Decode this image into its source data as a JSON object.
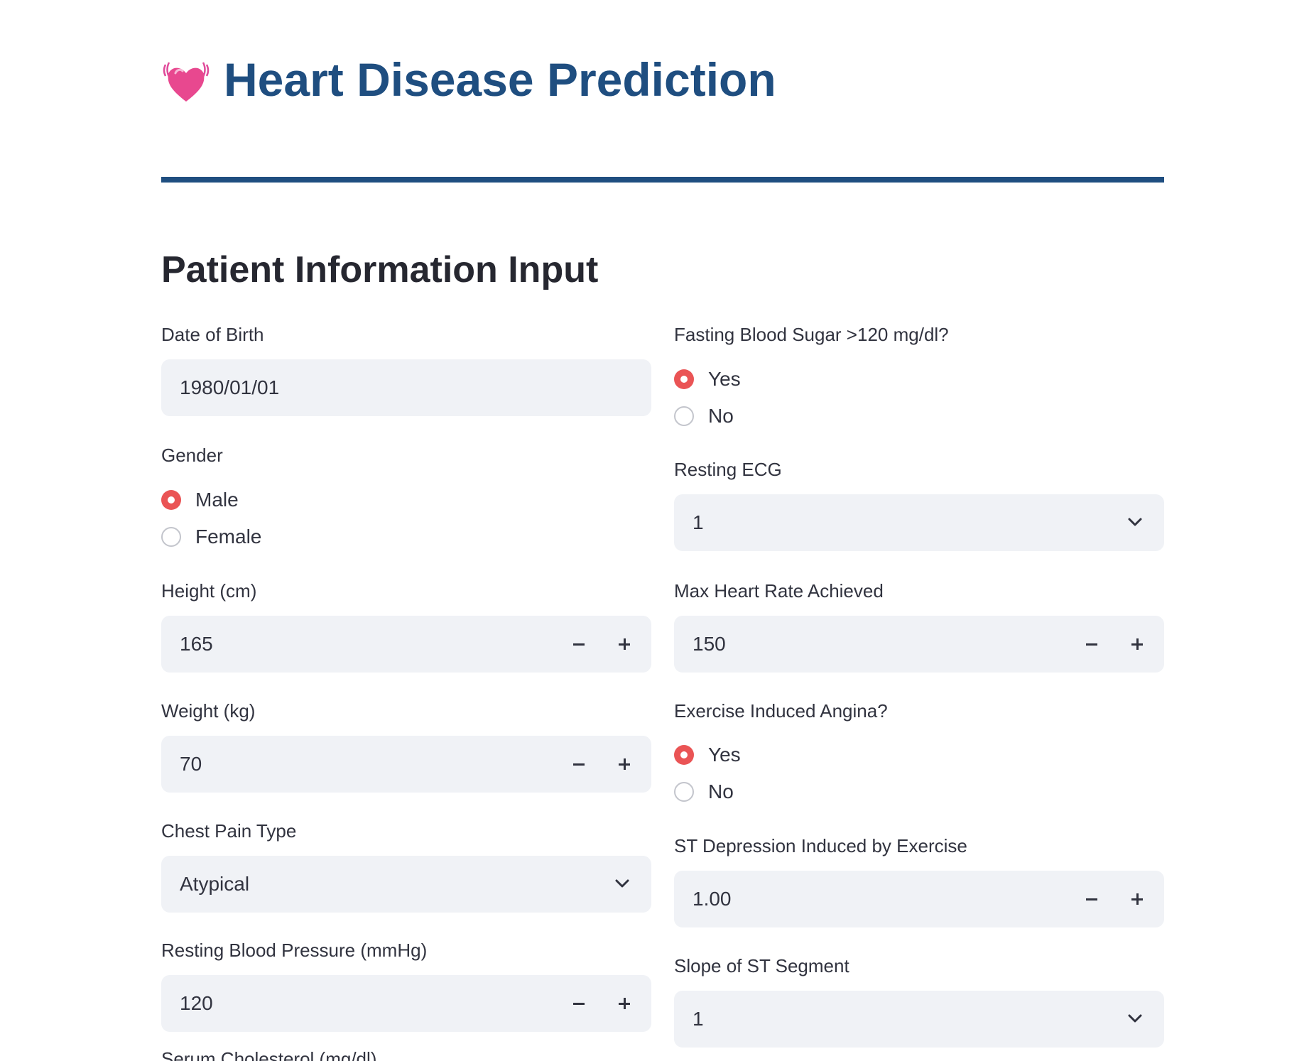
{
  "header": {
    "icon": "beating-heart-icon",
    "title": "Heart Disease Prediction"
  },
  "colors": {
    "title": "#1f4e80",
    "rule": "#1f4e80",
    "radio_checked": "#ea5455",
    "input_bg": "#f0f2f6"
  },
  "section_title": "Patient Information Input",
  "left": {
    "dob": {
      "label": "Date of Birth",
      "value": "1980/01/01"
    },
    "gender": {
      "label": "Gender",
      "options": [
        "Male",
        "Female"
      ],
      "selected": "Male"
    },
    "height": {
      "label": "Height (cm)",
      "value": "165"
    },
    "weight": {
      "label": "Weight (kg)",
      "value": "70"
    },
    "chest_pain": {
      "label": "Chest Pain Type",
      "value": "Atypical"
    },
    "resting_bp": {
      "label": "Resting Blood Pressure (mmHg)",
      "value": "120"
    },
    "cholesterol": {
      "label": "Serum Cholesterol (mg/dl)"
    }
  },
  "right": {
    "fbs": {
      "label": "Fasting Blood Sugar >120 mg/dl?",
      "options": [
        "Yes",
        "No"
      ],
      "selected": "Yes"
    },
    "resting_ecg": {
      "label": "Resting ECG",
      "value": "1"
    },
    "max_hr": {
      "label": "Max Heart Rate Achieved",
      "value": "150"
    },
    "angina": {
      "label": "Exercise Induced Angina?",
      "options": [
        "Yes",
        "No"
      ],
      "selected": "Yes"
    },
    "st_depression": {
      "label": "ST Depression Induced by Exercise",
      "value": "1.00"
    },
    "st_slope": {
      "label": "Slope of ST Segment",
      "value": "1"
    }
  }
}
